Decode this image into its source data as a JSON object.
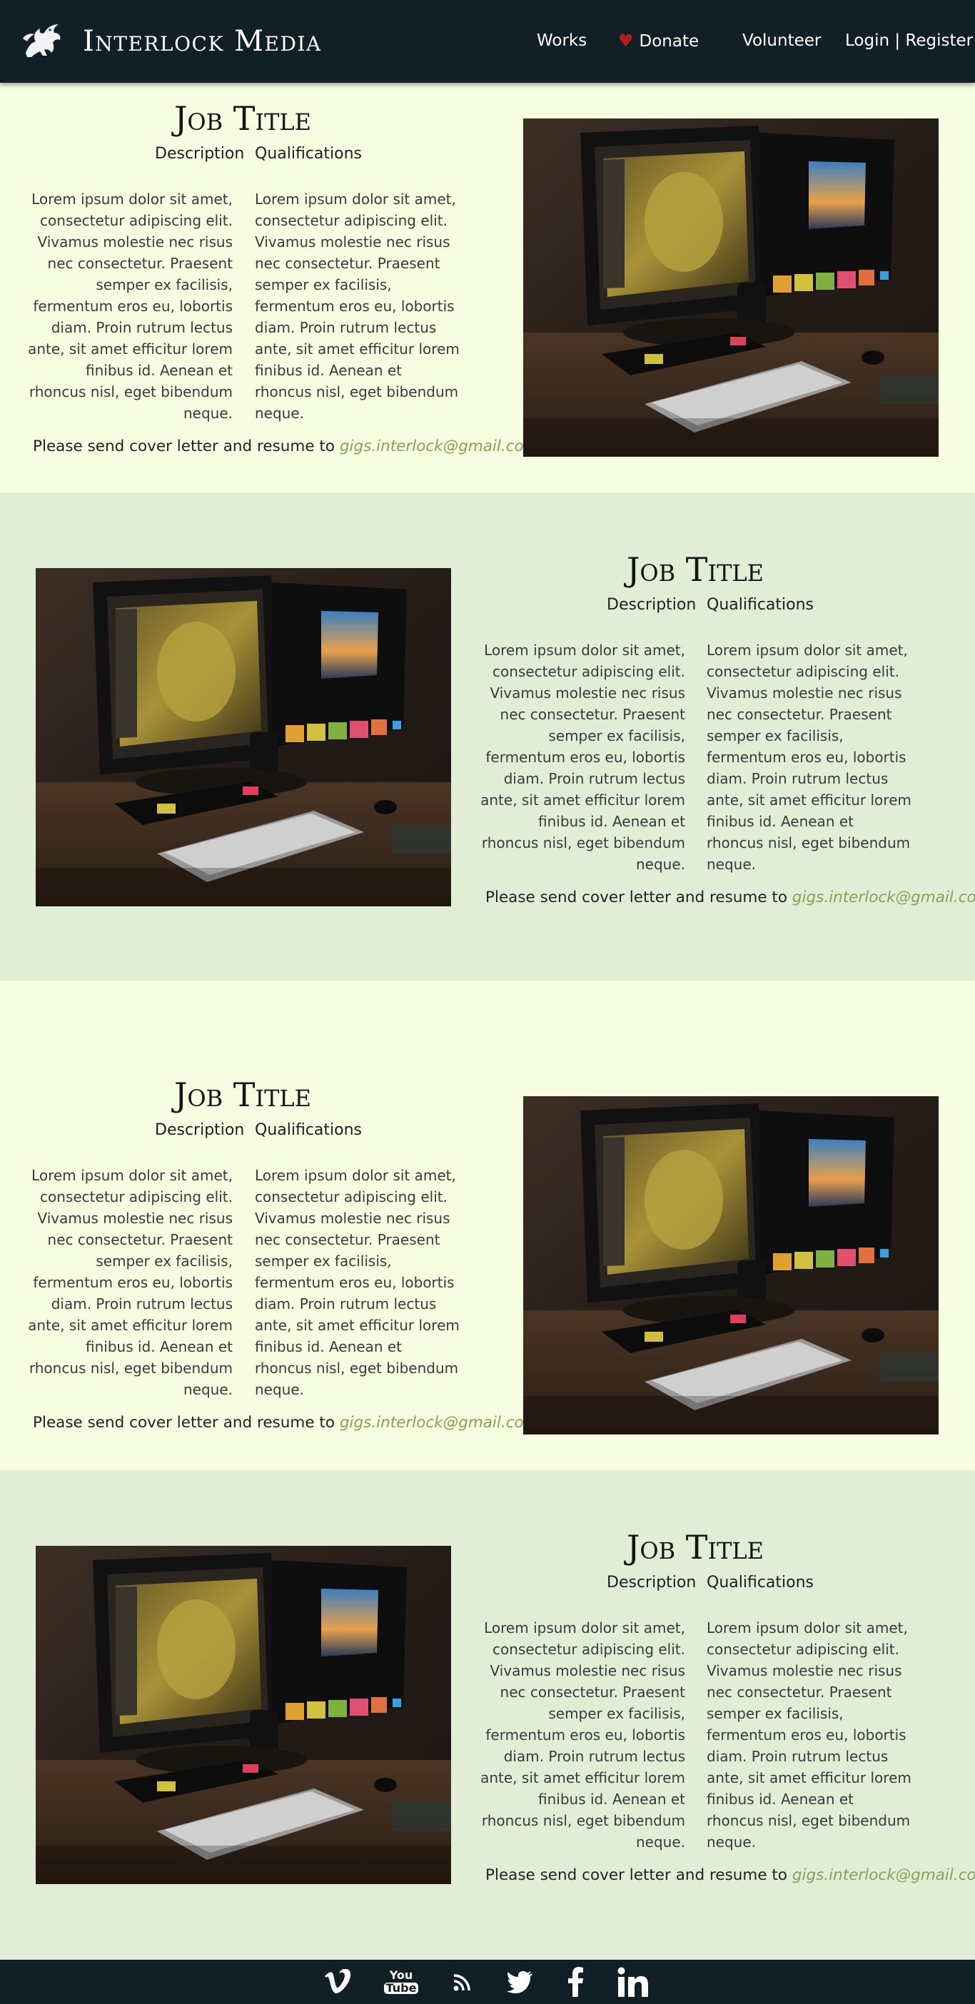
{
  "header": {
    "brand": "Interlock Media",
    "nav": {
      "works": "Works",
      "donate": "Donate",
      "volunteer": "Volunteer",
      "login_register": "Login | Register"
    },
    "colors": {
      "background": "#111f26",
      "heart": "#b1201d"
    }
  },
  "jobs": [
    {
      "title": "Job Title",
      "description_heading": "Description",
      "qualifications_heading": "Qualifications",
      "description": "Lorem ipsum dolor sit amet, consectetur adipiscing elit. Vivamus molestie nec risus nec consectetur. Praesent semper ex facilisis, fermentum eros eu, lobortis diam. Proin rutrum lectus ante, sit amet efficitur lorem finibus id. Aenean et rhoncus nisl, eget bibendum neque.",
      "qualifications": "Lorem ipsum dolor sit amet, consectetur adipiscing elit. Vivamus molestie nec risus nec consectetur. Praesent semper ex facilisis, fermentum eros eu, lobortis diam. Proin rutrum lectus ante, sit amet efficitur lorem finibus id. Aenean et rhoncus nisl, eget bibendum neque.",
      "apply_text": "Please send cover letter and resume to",
      "email": "gigs.interlock@gmail.com"
    },
    {
      "title": "Job Title",
      "description_heading": "Description",
      "qualifications_heading": "Qualifications",
      "description": "Lorem ipsum dolor sit amet, consectetur adipiscing elit. Vivamus molestie nec risus nec consectetur. Praesent semper ex facilisis, fermentum eros eu, lobortis diam. Proin rutrum lectus ante, sit amet efficitur lorem finibus id. Aenean et rhoncus nisl, eget bibendum neque.",
      "qualifications": "Lorem ipsum dolor sit amet, consectetur adipiscing elit. Vivamus molestie nec risus nec consectetur. Praesent semper ex facilisis, fermentum eros eu, lobortis diam. Proin rutrum lectus ante, sit amet efficitur lorem finibus id. Aenean et rhoncus nisl, eget bibendum neque.",
      "apply_text": "Please send cover letter and resume to",
      "email": "gigs.interlock@gmail.com"
    },
    {
      "title": "Job Title",
      "description_heading": "Description",
      "qualifications_heading": "Qualifications",
      "description": "Lorem ipsum dolor sit amet, consectetur adipiscing elit. Vivamus molestie nec risus nec consectetur. Praesent semper ex facilisis, fermentum eros eu, lobortis diam. Proin rutrum lectus ante, sit amet efficitur lorem finibus id. Aenean et rhoncus nisl, eget bibendum neque.",
      "qualifications": "Lorem ipsum dolor sit amet, consectetur adipiscing elit. Vivamus molestie nec risus nec consectetur. Praesent semper ex facilisis, fermentum eros eu, lobortis diam. Proin rutrum lectus ante, sit amet efficitur lorem finibus id. Aenean et rhoncus nisl, eget bibendum neque.",
      "apply_text": "Please send cover letter and resume to",
      "email": "gigs.interlock@gmail.com"
    },
    {
      "title": "Job Title",
      "description_heading": "Description",
      "qualifications_heading": "Qualifications",
      "description": "Lorem ipsum dolor sit amet, consectetur adipiscing elit. Vivamus molestie nec risus nec consectetur. Praesent semper ex facilisis, fermentum eros eu, lobortis diam. Proin rutrum lectus ante, sit amet efficitur lorem finibus id. Aenean et rhoncus nisl, eget bibendum neque.",
      "qualifications": "Lorem ipsum dolor sit amet, consectetur adipiscing elit. Vivamus molestie nec risus nec consectetur. Praesent semper ex facilisis, fermentum eros eu, lobortis diam. Proin rutrum lectus ante, sit amet efficitur lorem finibus id. Aenean et rhoncus nisl, eget bibendum neque.",
      "apply_text": "Please send cover letter and resume to",
      "email": "gigs.interlock@gmail.com"
    }
  ],
  "footer": {
    "social_icons": [
      "vimeo-icon",
      "youtube-icon",
      "rss-icon",
      "twitter-icon",
      "facebook-icon",
      "linkedin-icon"
    ],
    "youtube_you": "You",
    "youtube_tube": "Tube"
  },
  "colors": {
    "section_light": "#f6fde0",
    "section_green": "#e1eed5",
    "email_link": "#8aa055",
    "footer": "#111f26"
  }
}
